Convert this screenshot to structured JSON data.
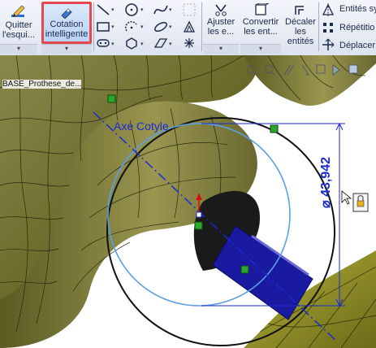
{
  "ribbon": {
    "quit_sketch": "Quitter\nl'esqui...",
    "smart_dimension": "Cotation\nintelligente",
    "trim": "Ajuster\nles e...",
    "convert": "Convertir\nles ent...",
    "offset": "Décaler\nles\nentités",
    "mirror": "Entités sy",
    "repeat": "Répétitio",
    "move": "Déplacer"
  },
  "viewport": {
    "feature_label": "BASE_Prothese_de...",
    "axis_label": "Axe Cotyle",
    "dimension_value": "⌀ 43,942"
  },
  "colors": {
    "accent_selection": "#e5484d",
    "sketch_blue": "#1a2bd0",
    "model_olive": "#6b6a2a"
  },
  "icons": [
    "pencil-exit-icon",
    "smart-dimension-icon",
    "line-icon",
    "circle-icon",
    "spline-icon",
    "rectangle-icon",
    "arc-icon",
    "polygon-icon",
    "slot-icon",
    "fillet-icon",
    "point-icon",
    "trim-icon",
    "convert-icon",
    "offset-icon",
    "mirror-icon",
    "pattern-icon",
    "move-icon"
  ]
}
